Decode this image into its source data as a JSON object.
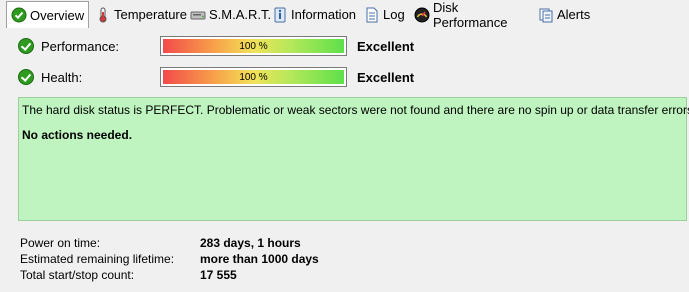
{
  "tabs": [
    {
      "label": "Overview",
      "icon": "check-circle-icon",
      "active": true
    },
    {
      "label": "Temperature",
      "icon": "thermometer-icon",
      "active": false
    },
    {
      "label": "S.M.A.R.T.",
      "icon": "hard-disk-icon",
      "active": false
    },
    {
      "label": "Information",
      "icon": "info-icon",
      "active": false
    },
    {
      "label": "Log",
      "icon": "log-document-icon",
      "active": false
    },
    {
      "label": "Disk Performance",
      "icon": "speedometer-icon",
      "active": false
    },
    {
      "label": "Alerts",
      "icon": "alerts-icon",
      "active": false
    }
  ],
  "metrics": {
    "performance": {
      "label": "Performance:",
      "percent_text": "100 %",
      "value": 1.0,
      "status": "Excellent"
    },
    "health": {
      "label": "Health:",
      "percent_text": "100 %",
      "value": 1.0,
      "status": "Excellent"
    }
  },
  "status_box": {
    "message": "The hard disk status is PERFECT. Problematic or weak sectors were not found and there are no spin up or data transfer errors.",
    "action": "No actions needed."
  },
  "info": [
    {
      "label": "Power on time:",
      "value": "283 days, 1 hours"
    },
    {
      "label": "Estimated remaining lifetime:",
      "value": "more than 1000 days"
    },
    {
      "label": "Total start/stop count:",
      "value": "17 555"
    }
  ],
  "colors": {
    "status_box_bg": "#bff3bf",
    "ok_green": "#2e9a20",
    "bar_low": "#f34a4a",
    "bar_high": "#5ee04a"
  }
}
